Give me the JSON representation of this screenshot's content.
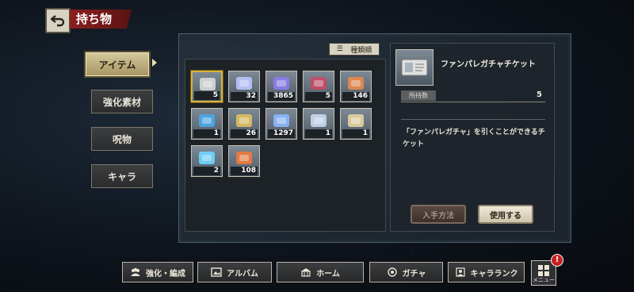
{
  "header": {
    "title": "持ち物"
  },
  "tabs": [
    {
      "label": "アイテム",
      "active": true
    },
    {
      "label": "強化素材",
      "active": false
    },
    {
      "label": "呪物",
      "active": false
    },
    {
      "label": "キャラ",
      "active": false
    }
  ],
  "sort": {
    "label": "種類順"
  },
  "items": [
    {
      "count": "5",
      "icon": "ticket-icon",
      "color": "#d9d9d9",
      "selected": true
    },
    {
      "count": "32",
      "icon": "potion-icon",
      "color": "#b9c6ff"
    },
    {
      "count": "3865",
      "icon": "crystal-icon",
      "color": "#8e7cf0"
    },
    {
      "count": "5",
      "icon": "gem-box-icon",
      "color": "#c64b64"
    },
    {
      "count": "146",
      "icon": "petals-icon",
      "color": "#e8894a"
    },
    {
      "count": "1",
      "icon": "tube-icon",
      "color": "#4aa8e8"
    },
    {
      "count": "26",
      "icon": "medal-icon",
      "color": "#e0c060"
    },
    {
      "count": "1297",
      "icon": "cloth-icon",
      "color": "#8bb8ff"
    },
    {
      "count": "1",
      "icon": "blade-icon",
      "color": "#c8d8f0"
    },
    {
      "count": "1",
      "icon": "scroll-icon",
      "color": "#e6d3a0"
    },
    {
      "count": "2",
      "icon": "card-icon",
      "color": "#6fd6ff"
    },
    {
      "count": "108",
      "icon": "orange-ticket-icon",
      "color": "#f07a3c"
    }
  ],
  "detail": {
    "name": "ファンパレガチャチケット",
    "own_label": "所持数",
    "own_value": "5",
    "description": "「ファンパレガチャ」を引くことができるチケット",
    "how_label": "入手方法",
    "use_label": "使用する"
  },
  "nav": [
    {
      "label": "強化・編成",
      "icon": "team-icon"
    },
    {
      "label": "アルバム",
      "icon": "album-icon"
    },
    {
      "label": "ホーム",
      "icon": "home-icon"
    },
    {
      "label": "ガチャ",
      "icon": "gacha-icon"
    },
    {
      "label": "キャラランク",
      "icon": "rank-icon"
    }
  ],
  "menu": {
    "label": "メニュー",
    "badge": "!"
  },
  "colors": {
    "accent_red": "#8c1f1f",
    "select_gold": "#d8b33a",
    "tab_active": "#c9bb8a"
  }
}
